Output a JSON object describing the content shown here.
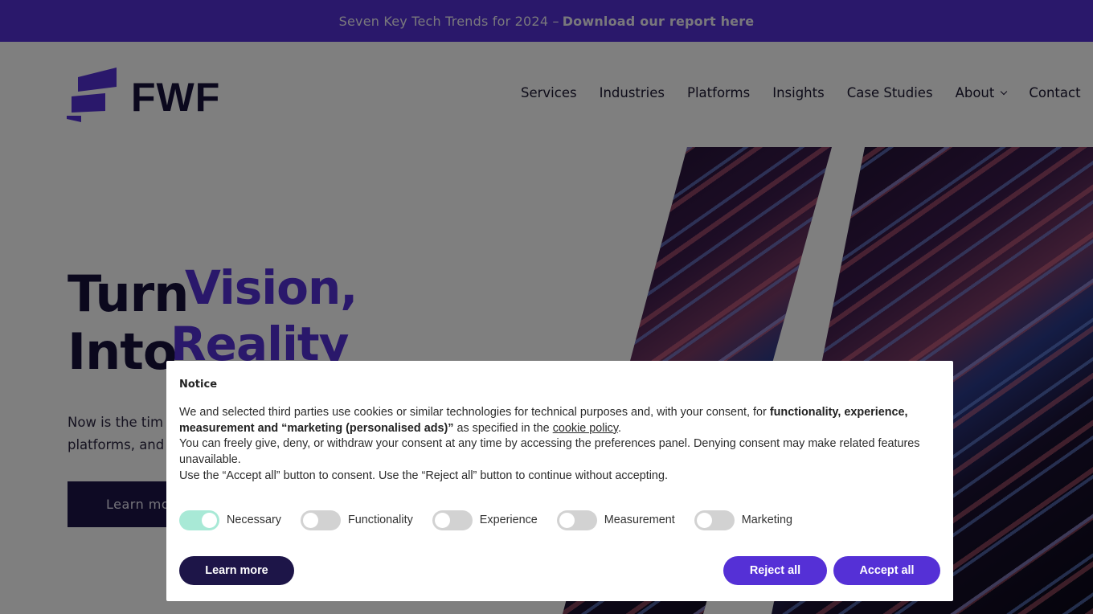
{
  "promo": {
    "text": "Seven Key Tech Trends for 2024 –",
    "link": "Download our report here"
  },
  "header": {
    "logo_text": "FWF",
    "nav": [
      {
        "label": "Services"
      },
      {
        "label": "Industries"
      },
      {
        "label": "Platforms"
      },
      {
        "label": "Insights"
      },
      {
        "label": "Case Studies"
      },
      {
        "label": "About",
        "has_dropdown": true
      },
      {
        "label": "Contact"
      }
    ]
  },
  "hero": {
    "line1": "Turn",
    "line2": "Into",
    "accent1": "Vision,",
    "accent2": "Reality",
    "subtitle_line1": "Now is the tim",
    "subtitle_line2": "platforms, and",
    "cta": "Learn mo"
  },
  "cookie_dialog": {
    "title": "Notice",
    "p1_a": "We and selected third parties use cookies or similar technologies for technical purposes and, with your consent, for ",
    "p1_bold": "functionality, experience, measurement and “marketing (personalised ads)”",
    "p1_b": " as specified in the ",
    "p1_link": "cookie policy",
    "p1_end": ".",
    "p2": "You can freely give, deny, or withdraw your consent at any time by accessing the preferences panel. Denying consent may make related features unavailable.",
    "p3": "Use the “Accept all” button to consent. Use the “Reject all” button to continue without accepting.",
    "toggles": [
      {
        "label": "Necessary",
        "on": true
      },
      {
        "label": "Functionality",
        "on": false
      },
      {
        "label": "Experience",
        "on": false
      },
      {
        "label": "Measurement",
        "on": false
      },
      {
        "label": "Marketing",
        "on": false
      }
    ],
    "learn_more": "Learn more",
    "reject_all": "Reject all",
    "accept_all": "Accept all"
  },
  "colors": {
    "brand_purple": "#5530d6",
    "brand_navy": "#1d1548",
    "toggle_on": "#a8e9d6",
    "toggle_off": "#d2d2d2"
  }
}
